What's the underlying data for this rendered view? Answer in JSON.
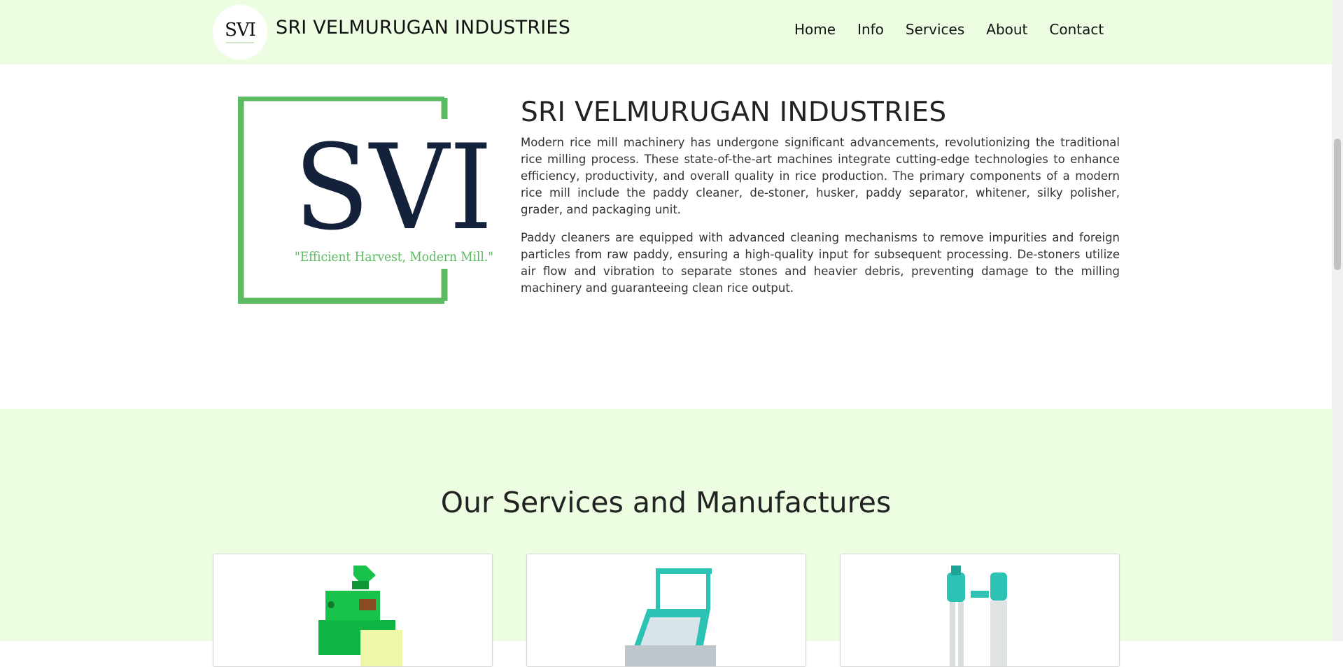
{
  "header": {
    "logo_text": "SVI",
    "brand_name": "SRI VELMURUGAN INDUSTRIES",
    "nav": [
      "Home",
      "Info",
      "Services",
      "About",
      "Contact"
    ]
  },
  "intro": {
    "logo_letters": "SVI",
    "logo_tagline": "\"Efficient Harvest, Modern Mill.\"",
    "title": "SRI VELMURUGAN INDUSTRIES",
    "paragraphs": [
      "Modern rice mill machinery has undergone significant advancements, revolutionizing the traditional rice milling process. These state-of-the-art machines integrate cutting-edge technologies to enhance efficiency, productivity, and overall quality in rice production. The primary components of a modern rice mill include the paddy cleaner, de-stoner, husker, paddy separator, whitener, silky polisher, grader, and packaging unit.",
      "Paddy cleaners are equipped with advanced cleaning mechanisms to remove impurities and foreign particles from raw paddy, ensuring a high-quality input for subsequent processing. De-stoners utilize air flow and vibration to separate stones and heavier debris, preventing damage to the milling machinery and guaranteeing clean rice output."
    ]
  },
  "services": {
    "title": "Our Services and Manufactures"
  },
  "colors": {
    "header_bg": "#edfde2",
    "logo_green": "#5cbb62",
    "logo_navy": "#13213a",
    "machine_teal": "#2cc2b4",
    "machine_green": "#19c24a"
  }
}
